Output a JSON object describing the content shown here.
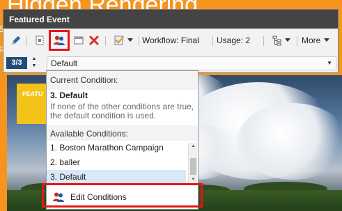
{
  "background": {
    "heading": "Hidden Rendering",
    "side_letter_1": "S",
    "side_letter_2": "R",
    "feature_tab": "FEATU"
  },
  "panel": {
    "title": "Featured Event",
    "workflow_label": "Workflow: Final",
    "usage_label": "Usage: 2",
    "more_label": "More"
  },
  "condition_bar": {
    "counter": "3/3",
    "selected_value": "Default"
  },
  "dropdown": {
    "current_heading": "Current Condition:",
    "current_name": "3. Default",
    "current_description": "If none of the other conditions are true, the default condition is used.",
    "available_heading": "Available Conditions:",
    "items": [
      {
        "label": "1. Boston Marathon Campaign"
      },
      {
        "label": "2. baller"
      },
      {
        "label": "3. Default"
      }
    ],
    "edit_label": "Edit Conditions"
  },
  "colors": {
    "accent_orange": "#f7941d",
    "title_bar": "#444444",
    "highlight_red": "#e8141b",
    "counter_blue": "#1f4d7a",
    "selected_row": "#d9e8f5"
  },
  "icons": [
    "pencil-icon",
    "personalize-icon",
    "layout-icon",
    "delete-icon",
    "approve-icon",
    "hierarchy-icon",
    "dropdown-arrow-icon"
  ]
}
